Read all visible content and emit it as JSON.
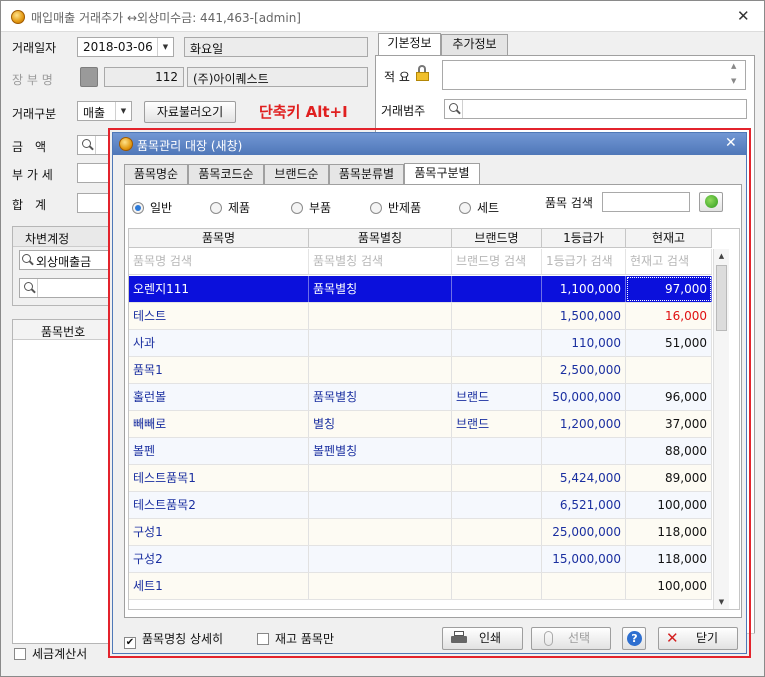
{
  "window": {
    "title": "매입매출 거래추가 ↔외상미수금: 441,463-[admin]"
  },
  "form": {
    "trade_date_label": "거래일자",
    "trade_date_value": "2018-03-06",
    "weekday_value": "화요일",
    "ledger_label": "장 부 명",
    "ledger_code": "112",
    "ledger_name": "(주)아이퀘스트",
    "trade_type_label": "거래구분",
    "trade_type_value": "매출",
    "load_button": "자료불러오기",
    "shortcut_text": "단축키 Alt+I",
    "amount_label": "금　액",
    "vat_label": "부 가 세",
    "total_label": "합　계",
    "debit_label": "차변계정",
    "debit_value": "외상매출금",
    "item_no_label": "품목번호",
    "tax_invoice_label": "세금계산서",
    "tabs": [
      "기본정보",
      "추가정보"
    ],
    "memo_label": "적 요",
    "category_label": "거래범주"
  },
  "dialog": {
    "title": "품목관리 대장 (새창)",
    "tabs": [
      "품목명순",
      "품목코드순",
      "브랜드순",
      "품목분류별",
      "품목구분별"
    ],
    "radios": [
      "일반",
      "제품",
      "부품",
      "반제품",
      "세트"
    ],
    "item_search_label": "품목 검색",
    "columns": [
      "품목명",
      "품목별칭",
      "브랜드명",
      "1등급가",
      "현재고"
    ],
    "filters": [
      "품목명 검색",
      "품목별칭 검색",
      "브랜드명 검색",
      "1등급가 검색",
      "현재고 검색"
    ],
    "rows": [
      {
        "name": "오렌지111",
        "alias": "품목별칭",
        "brand": "",
        "price": "1,100,000",
        "stock": "97,000"
      },
      {
        "name": "테스트",
        "alias": "",
        "brand": "",
        "price": "1,500,000",
        "stock": "16,000"
      },
      {
        "name": "사과",
        "alias": "",
        "brand": "",
        "price": "110,000",
        "stock": "51,000"
      },
      {
        "name": "품목1",
        "alias": "",
        "brand": "",
        "price": "2,500,000",
        "stock": ""
      },
      {
        "name": "홀런볼",
        "alias": "품목별칭",
        "brand": "브랜드",
        "price": "50,000,000",
        "stock": "96,000"
      },
      {
        "name": "빼빼로",
        "alias": "별칭",
        "brand": "브랜드",
        "price": "1,200,000",
        "stock": "37,000"
      },
      {
        "name": "볼펜",
        "alias": "볼펜별칭",
        "brand": "",
        "price": "",
        "stock": "88,000"
      },
      {
        "name": "테스트품목1",
        "alias": "",
        "brand": "",
        "price": "5,424,000",
        "stock": "89,000"
      },
      {
        "name": "테스트품목2",
        "alias": "",
        "brand": "",
        "price": "6,521,000",
        "stock": "100,000"
      },
      {
        "name": "구성1",
        "alias": "",
        "brand": "",
        "price": "25,000,000",
        "stock": "118,000"
      },
      {
        "name": "구성2",
        "alias": "",
        "brand": "",
        "price": "15,000,000",
        "stock": "118,000"
      },
      {
        "name": "세트1",
        "alias": "",
        "brand": "",
        "price": "",
        "stock": "100,000"
      }
    ],
    "detail_checkbox": "품목명칭 상세히",
    "stock_checkbox": "재고 품목만",
    "print_button": "인쇄",
    "select_button": "선택",
    "close_button": "닫기"
  },
  "colors": {
    "selected_row": "#0b10dc",
    "negative_stock": "#e01010",
    "shortcut_red": "#e02020",
    "dialog_frame": "#e3232c"
  }
}
